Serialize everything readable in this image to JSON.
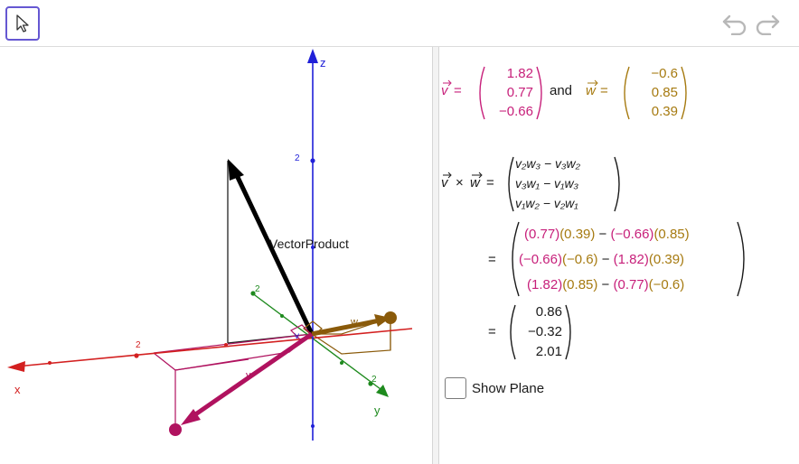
{
  "toolbar": {
    "tool_icon": "move-cursor-icon",
    "undo_icon": "undo-icon",
    "redo_icon": "redo-icon"
  },
  "view3d": {
    "axis_x_label": "x",
    "axis_y_label": "y",
    "axis_z_label": "z",
    "tick_x": "2",
    "tick_y": "2",
    "tick_z": "2",
    "tick_y2": "2",
    "vector_product_label": "VectorProduct",
    "v_label": "v",
    "w_label": "w",
    "v_small_label": "v",
    "colors": {
      "x_axis": "#d32020",
      "y_axis": "#1e8a1e",
      "z_axis": "#2020d8",
      "v": "#b0125f",
      "w": "#8a5a0a",
      "product": "#000000"
    }
  },
  "algebra": {
    "def": {
      "v_sym": "v",
      "eq": "=",
      "and": "and",
      "w_sym": "w",
      "v": [
        "1.82",
        "0.77",
        "−0.66"
      ],
      "w": [
        "−0.6",
        "0.85",
        "0.39"
      ]
    },
    "cross": {
      "lhs_v": "v",
      "times": "×",
      "lhs_w": "w",
      "eq": "=",
      "formula": [
        "v₂w₃ − v₃w₂",
        "v₃w₁ − v₁w₃",
        "v₁w₂ − v₂w₁"
      ]
    },
    "subst": {
      "eq": "=",
      "rows": [
        {
          "a": "(0.77)",
          "b": "(0.39)",
          "op": " − ",
          "c": "(−0.66)",
          "d": "(0.85)"
        },
        {
          "a": "(−0.66)",
          "b": "(−0.6)",
          "op": " − ",
          "c": "(1.82)",
          "d": "(0.39)"
        },
        {
          "a": "(1.82)",
          "b": "(0.85)",
          "op": " − ",
          "c": "(0.77)",
          "d": "(−0.6)"
        }
      ]
    },
    "result": {
      "eq": "=",
      "values": [
        "0.86",
        "−0.32",
        "2.01"
      ]
    },
    "show_plane": {
      "label": "Show Plane",
      "checked": false
    }
  }
}
